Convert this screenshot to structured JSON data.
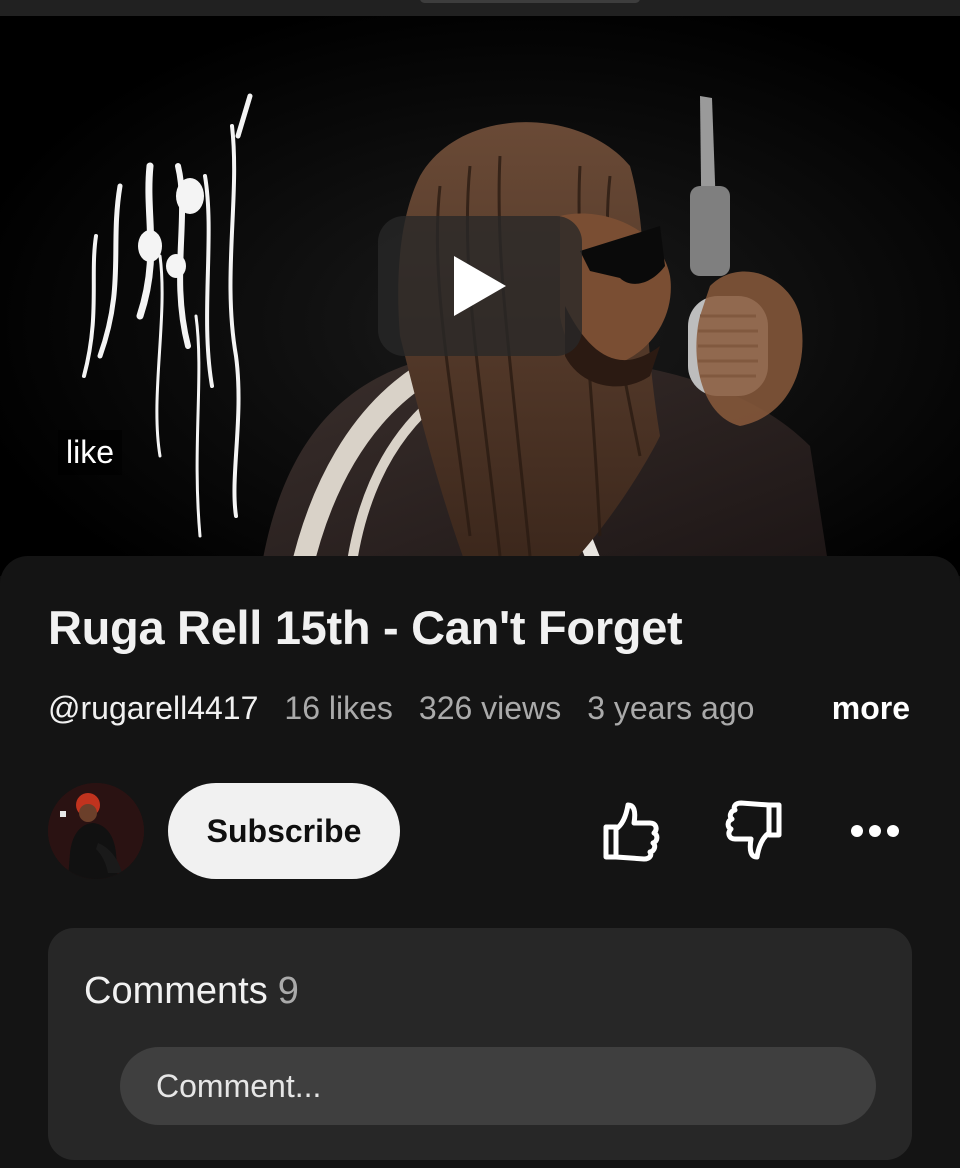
{
  "video": {
    "overlay_text": "like"
  },
  "title": "Ruga Rell 15th - Can't Forget",
  "meta": {
    "channel_handle": "@rugarell4417",
    "likes": "16 likes",
    "views": "326 views",
    "age": "3 years ago",
    "more_label": "more"
  },
  "actions": {
    "subscribe_label": "Subscribe"
  },
  "comments": {
    "label": "Comments",
    "count": "9",
    "placeholder": "Comment..."
  },
  "icons": {
    "play": "play-icon",
    "like": "thumbs-up-icon",
    "dislike": "thumbs-down-icon",
    "more": "more-options-icon"
  },
  "colors": {
    "background": "#0f0f0f",
    "panel": "#141414",
    "card": "#272727",
    "input": "#3f3f3f",
    "subscribe_bg": "#f1f1f1",
    "muted_text": "#aaaaaa"
  }
}
